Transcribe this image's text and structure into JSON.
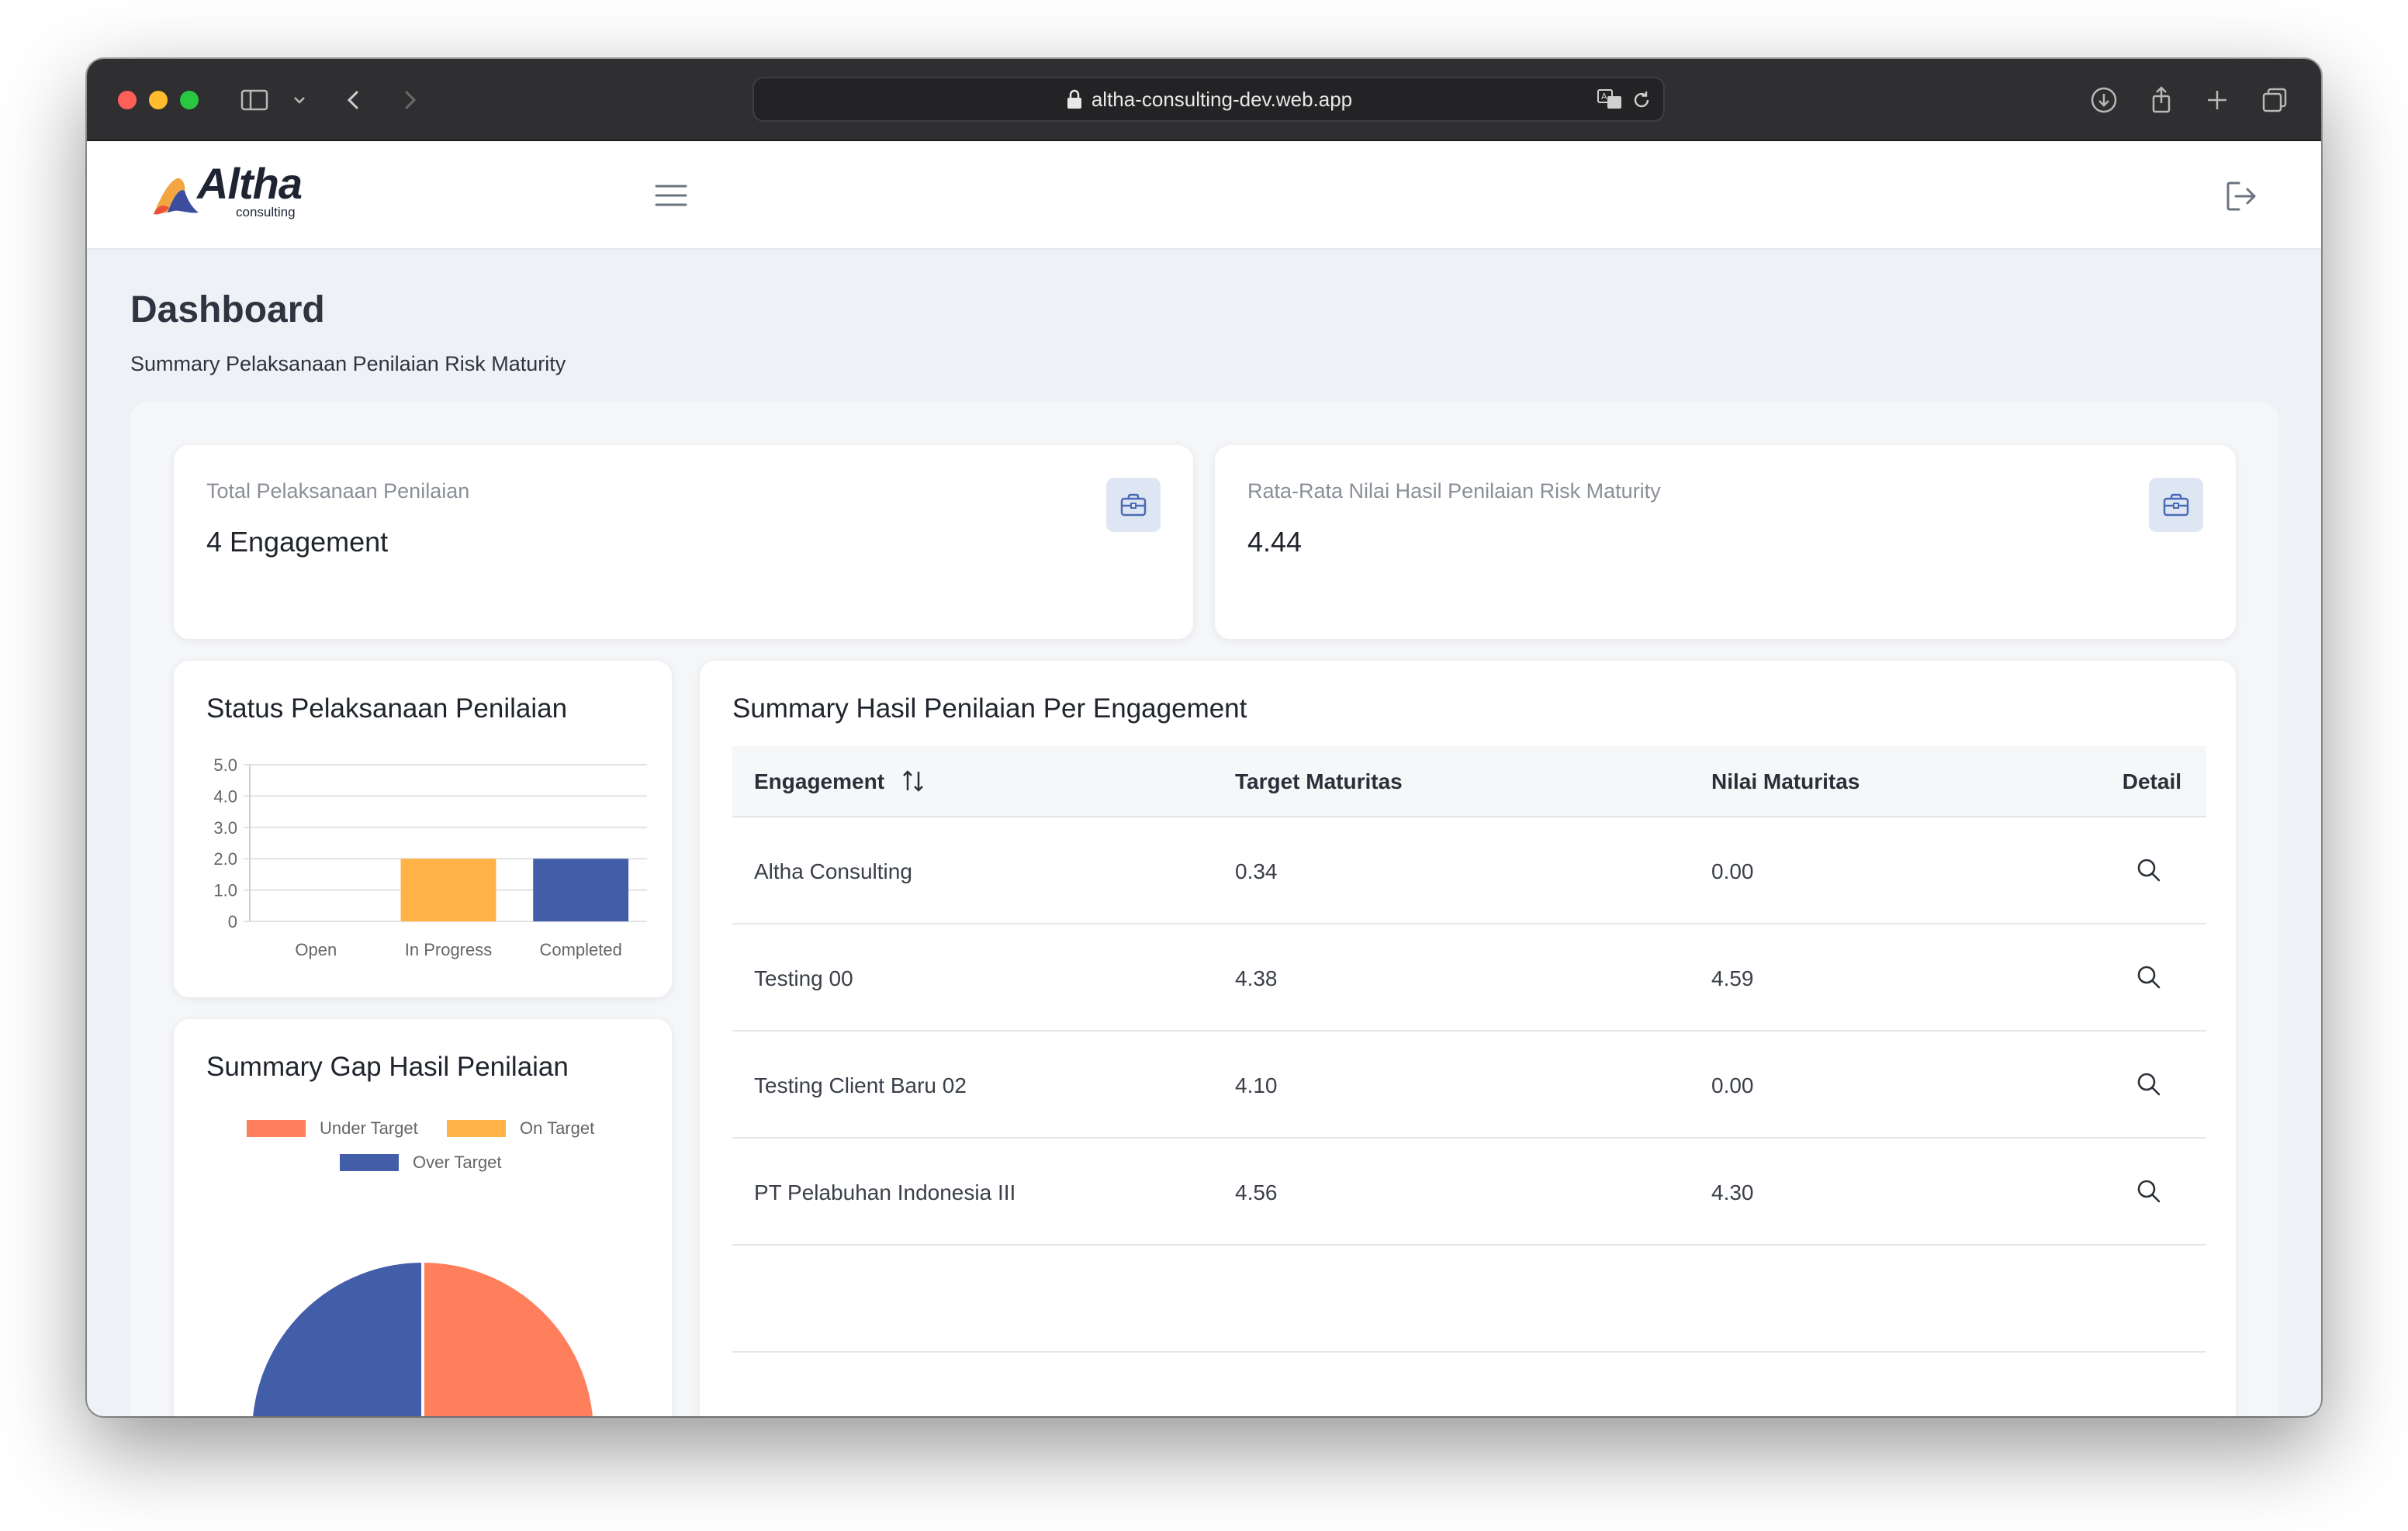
{
  "browser": {
    "url": "altha-consulting-dev.web.app"
  },
  "app": {
    "logo_text": "Altha",
    "logo_subtext": "consulting"
  },
  "page": {
    "title": "Dashboard",
    "subtitle": "Summary Pelaksanaan Penilaian Risk Maturity"
  },
  "stats": [
    {
      "label": "Total Pelaksanaan Penilaian",
      "value": "4 Engagement",
      "icon": "briefcase-icon"
    },
    {
      "label": "Rata-Rata Nilai Hasil Penilaian Risk Maturity",
      "value": "4.44",
      "icon": "briefcase-icon"
    }
  ],
  "status_card": {
    "title": "Status Pelaksanaan Penilaian"
  },
  "gap_card": {
    "title": "Summary Gap Hasil Penilaian"
  },
  "table_card": {
    "title": "Summary Hasil Penilaian Per Engagement",
    "headers": {
      "engagement": "Engagement",
      "target": "Target Maturitas",
      "nilai": "Nilai Maturitas",
      "detail": "Detail"
    },
    "rows": [
      {
        "engagement": "Altha Consulting",
        "target": "0.34",
        "nilai": "0.00"
      },
      {
        "engagement": "Testing 00",
        "target": "4.38",
        "nilai": "4.59"
      },
      {
        "engagement": "Testing Client Baru 02",
        "target": "4.10",
        "nilai": "0.00"
      },
      {
        "engagement": "PT Pelabuhan Indonesia III",
        "target": "4.56",
        "nilai": "4.30"
      }
    ]
  },
  "colors": {
    "orange": "#ffb347",
    "blue": "#435ea8",
    "coral": "#ff7f5c"
  },
  "chart_data": [
    {
      "type": "bar",
      "categories": [
        "Open",
        "In Progress",
        "Completed"
      ],
      "values": [
        0,
        2,
        2
      ],
      "bar_colors": [
        "#ffb347",
        "#ffb347",
        "#435ea8"
      ],
      "ylim": [
        0,
        5
      ],
      "yticks": [
        "0",
        "1.0",
        "2.0",
        "3.0",
        "4.0",
        "5.0"
      ],
      "grid": true
    },
    {
      "type": "pie",
      "labels": [
        "Under Target",
        "On Target",
        "Over Target"
      ],
      "values": [
        2,
        0,
        2
      ],
      "colors": [
        "#ff7f5c",
        "#ffb347",
        "#435ea8"
      ],
      "legend_position": "top"
    }
  ]
}
